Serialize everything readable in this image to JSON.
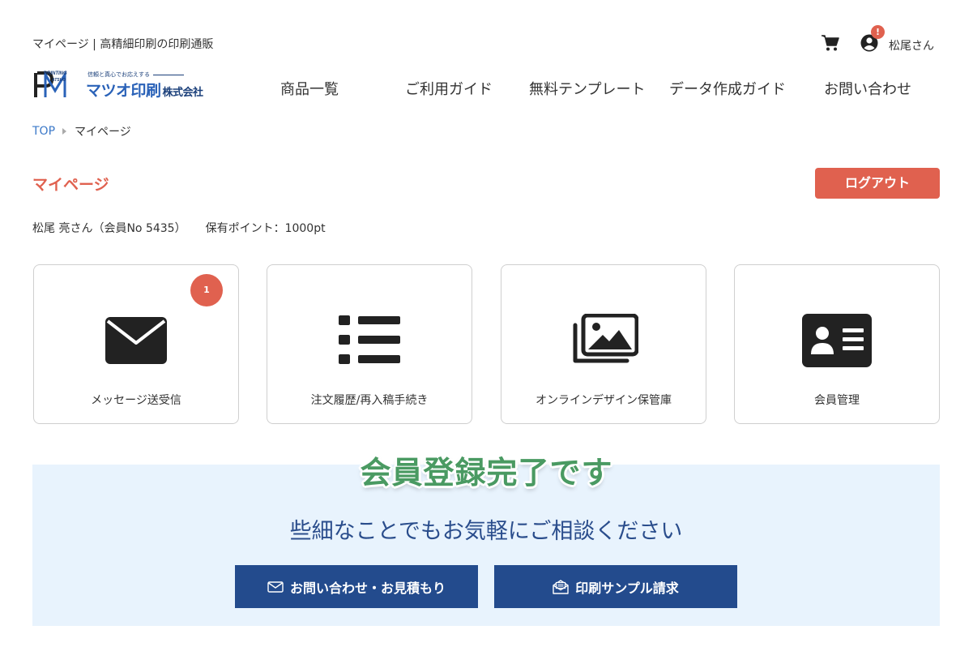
{
  "header": {
    "tagline": "マイページ | 高精細印刷の印刷通販",
    "logo": {
      "tagline": "信頼と真心でお応えする",
      "name": "マツオ印刷",
      "corp": "株式会社"
    },
    "user_name": "松尾さん",
    "notification_badge": "!"
  },
  "nav": {
    "items": [
      {
        "label": "商品一覧"
      },
      {
        "label": "ご利用ガイド"
      },
      {
        "label": "無料テンプレート"
      },
      {
        "label": "データ作成ガイド"
      },
      {
        "label": "お問い合わせ"
      }
    ]
  },
  "breadcrumb": {
    "home": "TOP",
    "current": "マイページ"
  },
  "page": {
    "title": "マイページ",
    "logout_label": "ログアウト",
    "member_name": "松尾 亮さん（会員No 5435）",
    "points": "保有ポイント：1000pt"
  },
  "cards": [
    {
      "label": "メッセージ送受信",
      "icon": "envelope-icon",
      "badge": "1"
    },
    {
      "label": "注文履歴/再入稿手続き",
      "icon": "list-icon"
    },
    {
      "label": "オンラインデザイン保管庫",
      "icon": "images-icon"
    },
    {
      "label": "会員管理",
      "icon": "id-card-icon"
    }
  ],
  "overlay": {
    "message": "会員登録完了です"
  },
  "consult": {
    "title": "些細なことでもお気軽にご相談ください",
    "contact_label": "お問い合わせ・お見積もり",
    "sample_label": "印刷サンプル請求"
  },
  "colors": {
    "accent": "#e0614f",
    "navy": "#234b8d",
    "link": "#3b78c8",
    "success": "#4a9a62",
    "consult_bg": "#e8f3fd"
  }
}
